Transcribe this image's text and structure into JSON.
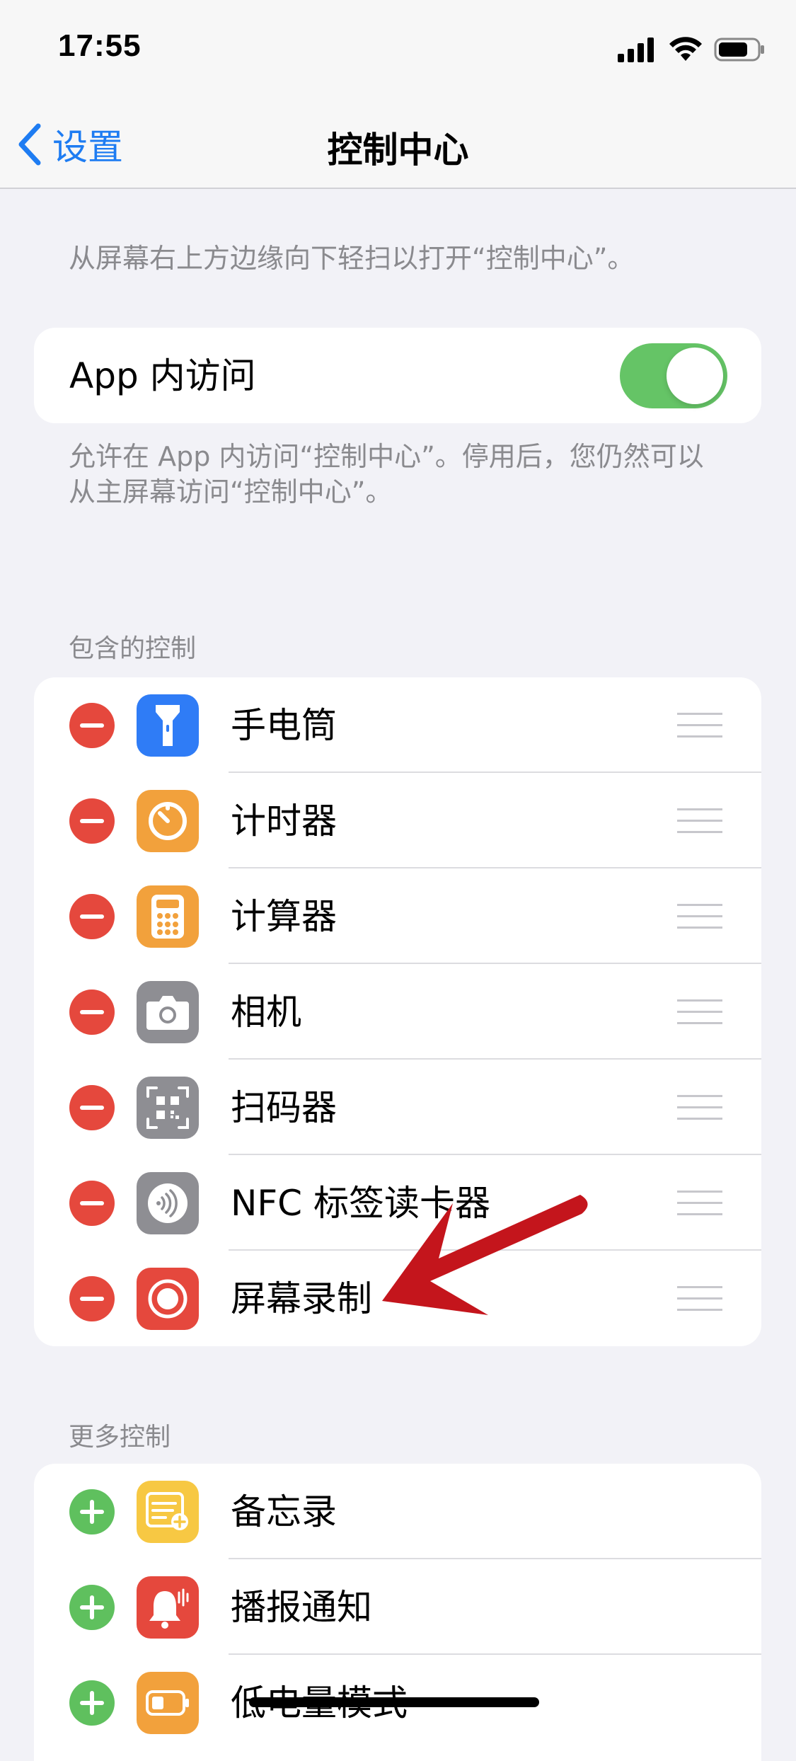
{
  "status_bar": {
    "time": "17:55"
  },
  "nav": {
    "back_label": "设置",
    "title": "控制中心"
  },
  "intro_text": "从屏幕右上方边缘向下轻扫以打开“控制中心”。",
  "app_access": {
    "label": "App 内访问",
    "enabled": true,
    "footer_line1": "允许在 App 内访问“控制中心”。停用后，您仍然可以",
    "footer_line2": "从主屏幕访问“控制中心”。"
  },
  "included": {
    "header": "包含的控制",
    "items": [
      {
        "label": "手电筒",
        "icon": "flashlight-icon",
        "color": "#2f7cf6"
      },
      {
        "label": "计时器",
        "icon": "timer-icon",
        "color": "#f2a13c"
      },
      {
        "label": "计算器",
        "icon": "calculator-icon",
        "color": "#f2a13c"
      },
      {
        "label": "相机",
        "icon": "camera-icon",
        "color": "#8e8e93"
      },
      {
        "label": "扫码器",
        "icon": "qr-code-icon",
        "color": "#8e8e93"
      },
      {
        "label": "NFC 标签读卡器",
        "icon": "nfc-icon",
        "color": "#8e8e93"
      },
      {
        "label": "屏幕录制",
        "icon": "screen-record-icon",
        "color": "#e5483d"
      }
    ]
  },
  "more": {
    "header": "更多控制",
    "items": [
      {
        "label": "备忘录",
        "icon": "notes-icon",
        "color": "#f7c843"
      },
      {
        "label": "播报通知",
        "icon": "announce-notifications-icon",
        "color": "#e5483d"
      },
      {
        "label": "低电量模式",
        "icon": "low-power-icon",
        "color": "#f2a13c"
      }
    ]
  },
  "colors": {
    "accent": "#1e7cf2",
    "toggle_on": "#65c466",
    "remove": "#e5483d",
    "add": "#5fc05e",
    "annotation_arrow": "#c4151c"
  }
}
